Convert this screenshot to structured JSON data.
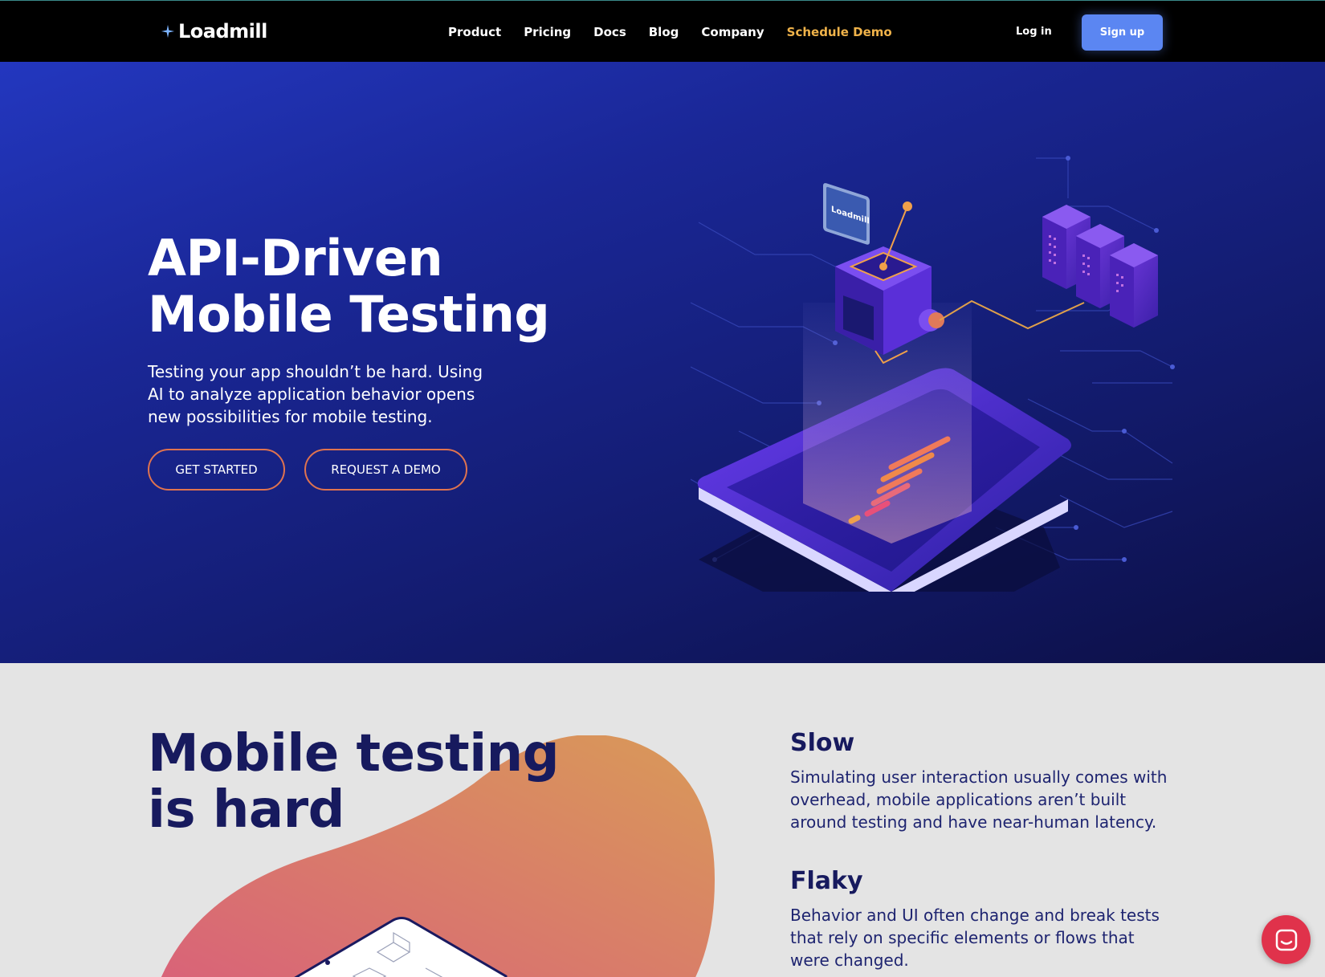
{
  "nav": {
    "logo": "Loadmill",
    "links": [
      "Product",
      "Pricing",
      "Docs",
      "Blog",
      "Company",
      "Schedule Demo"
    ],
    "login": "Log in",
    "signup": "Sign up"
  },
  "hero": {
    "title_line1": "API-Driven",
    "title_line2": "Mobile Testing",
    "subtitle": "Testing your app shouldn’t be hard. Using AI to analyze application behavior opens new possibilities for mobile testing.",
    "get_started": "GET STARTED",
    "request_demo": "REQUEST A DEMO",
    "illustration_logo": "Loadmill"
  },
  "section2": {
    "title_line1": "Mobile testing",
    "title_line2": "is hard",
    "features": [
      {
        "title": "Slow",
        "text": "Simulating user interaction usually comes with overhead, mobile applications aren’t built around testing and have near-human latency."
      },
      {
        "title": "Flaky",
        "text": "Behavior and UI often change and break tests that rely on specific elements or flows that were changed."
      }
    ]
  },
  "colors": {
    "nav_bg": "#000000",
    "accent_yellow": "#f0b34a",
    "signup_blue": "#5b86f2",
    "hero_dark": "#121a6a",
    "heading_navy": "#171a5e",
    "button_border": "#e0734f",
    "chat_red": "#e0324b"
  },
  "icons": [
    "loadmill-logo-icon",
    "chat-icon"
  ]
}
